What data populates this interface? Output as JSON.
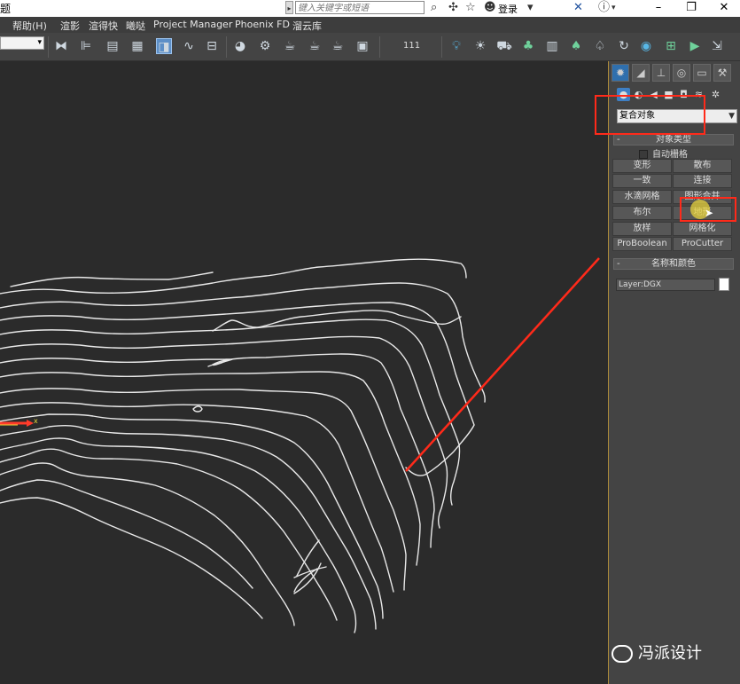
{
  "title_bar": {
    "title": "题",
    "search_placeholder": "键入关键字或短语",
    "login": "登录"
  },
  "menu": [
    "帮助(H)",
    "渲影",
    "渲得快",
    "曦哒",
    "Project Manager",
    "Phoenix FD",
    "溜云库"
  ],
  "toolbar": {
    "selection_value": "",
    "counter": "111"
  },
  "command_panel": {
    "category": "复合对象",
    "object_type_header": "对象类型",
    "auto_grid_label": "自动栅格",
    "buttons": [
      [
        "变形",
        "散布"
      ],
      [
        "一致",
        "连接"
      ],
      [
        "水滴网格",
        "图形合并"
      ],
      [
        "布尔",
        "地形"
      ],
      [
        "放样",
        "网格化"
      ],
      [
        "ProBoolean",
        "ProCutter"
      ]
    ],
    "name_color_header": "名称和颜色",
    "name_value": "Layer:DGX"
  },
  "viewport": {
    "axis_label": "x"
  },
  "watermark": "冯派设计",
  "colors": {
    "highlight_red": "#ff2a1a",
    "viewport_bg": "#2b2b2b",
    "panel_bg": "#444444",
    "accent_blue": "#3e7fc4"
  }
}
